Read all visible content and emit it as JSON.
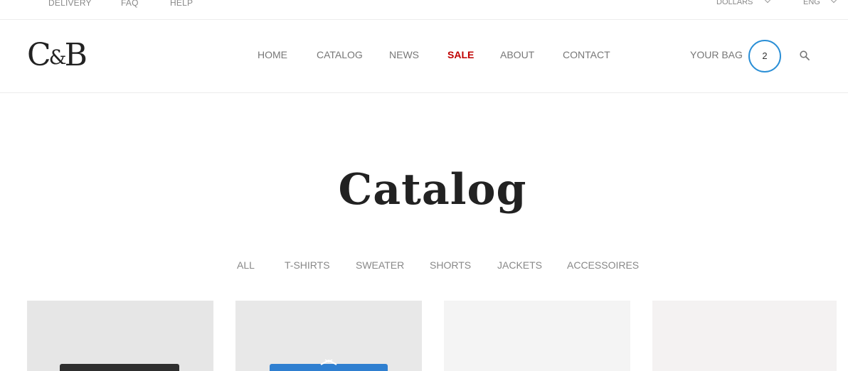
{
  "topbar": {
    "links": [
      "DELIVERY",
      "FAQ",
      "HELP"
    ],
    "currency": "DOLLARS",
    "language": "ENG"
  },
  "header": {
    "logo": {
      "left": "C",
      "amp": "&",
      "right": "B"
    },
    "nav": [
      "HOME",
      "CATALOG",
      "NEWS",
      "SALE",
      "ABOUT",
      "CONTACT"
    ],
    "bag_label": "YOUR BAG",
    "bag_count": "2",
    "search_icon": "search-icon"
  },
  "main": {
    "title": "Catalog",
    "filters": [
      "ALL",
      "T-SHIRTS",
      "SWEATER",
      "SHORTS",
      "JACKETS",
      "ACCESSOIRES"
    ]
  },
  "colors": {
    "accent": "#2b8fd6",
    "sale": "#c00000",
    "card_backgrounds": [
      "#e6e6e6",
      "#e8e8e8",
      "#f4f4f4",
      "#f4f2f2"
    ],
    "product_colors": [
      "#2e2e2e",
      "#2f7fd0"
    ]
  }
}
